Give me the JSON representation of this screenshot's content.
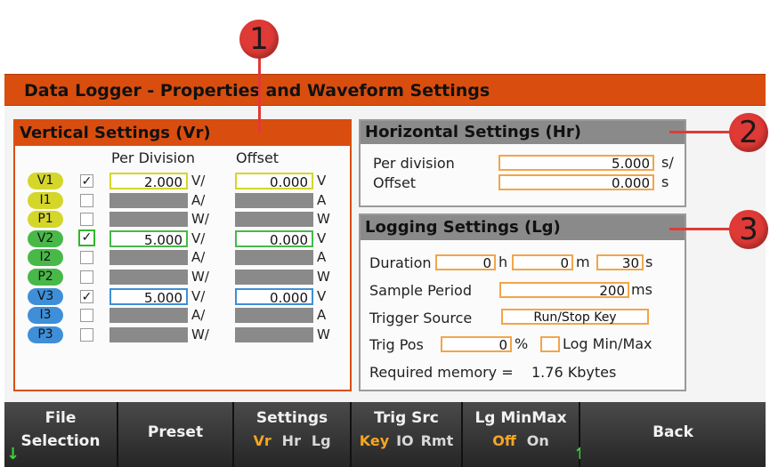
{
  "title": "Data Logger - Properties and Waveform Settings",
  "callouts": [
    "1",
    "2",
    "3"
  ],
  "vertical": {
    "heading": "Vertical Settings (Vr)",
    "col_per_div": "Per Division",
    "col_offset": "Offset",
    "rows": [
      {
        "label": "V1",
        "checked": "✓",
        "per_div": "2.000",
        "per_unit": "V/",
        "offset": "0.000",
        "off_unit": "V",
        "color": "#d4d62a"
      },
      {
        "label": "I1",
        "checked": "",
        "per_div": "",
        "per_unit": "A/",
        "offset": "",
        "off_unit": "A",
        "color": "#d4d62a"
      },
      {
        "label": "P1",
        "checked": "",
        "per_div": "",
        "per_unit": "W/",
        "offset": "",
        "off_unit": "W",
        "color": "#d4d62a"
      },
      {
        "label": "V2",
        "checked": "✓",
        "per_div": "5.000",
        "per_unit": "V/",
        "offset": "0.000",
        "off_unit": "V",
        "color": "#48b848"
      },
      {
        "label": "I2",
        "checked": "",
        "per_div": "",
        "per_unit": "A/",
        "offset": "",
        "off_unit": "A",
        "color": "#48b848"
      },
      {
        "label": "P2",
        "checked": "",
        "per_div": "",
        "per_unit": "W/",
        "offset": "",
        "off_unit": "W",
        "color": "#48b848"
      },
      {
        "label": "V3",
        "checked": "✓",
        "per_div": "5.000",
        "per_unit": "V/",
        "offset": "0.000",
        "off_unit": "V",
        "color": "#3e8fd8"
      },
      {
        "label": "I3",
        "checked": "",
        "per_div": "",
        "per_unit": "A/",
        "offset": "",
        "off_unit": "A",
        "color": "#3e8fd8"
      },
      {
        "label": "P3",
        "checked": "",
        "per_div": "",
        "per_unit": "W/",
        "offset": "",
        "off_unit": "W",
        "color": "#3e8fd8"
      }
    ]
  },
  "horizontal": {
    "heading": "Horizontal Settings (Hr)",
    "per_division_label": "Per division",
    "per_division_value": "5.000",
    "per_division_unit": "s/",
    "offset_label": "Offset",
    "offset_value": "0.000",
    "offset_unit": "s"
  },
  "logging": {
    "heading": "Logging Settings (Lg)",
    "duration_label": "Duration",
    "duration_h": "0",
    "h_unit": "h",
    "duration_m": "0",
    "m_unit": "m",
    "duration_s": "30",
    "s_unit": "s",
    "sample_label": "Sample Period",
    "sample_value": "200",
    "sample_unit": "ms",
    "trigger_label": "Trigger Source",
    "trigger_value": "Run/Stop Key",
    "trigpos_label": "Trig Pos",
    "trigpos_value": "0",
    "trigpos_unit": "%",
    "logminmax_label": "Log Min/Max",
    "memory_label": "Required memory =",
    "memory_value": "1.76 Kbytes"
  },
  "softkeys": {
    "file_line1": "File",
    "file_line2": "Selection",
    "preset": "Preset",
    "settings": "Settings",
    "settings_opts": [
      "Vr",
      "Hr",
      "Lg"
    ],
    "trig": "Trig Src",
    "trig_opts": [
      "Key",
      "IO",
      "Rmt"
    ],
    "lgminmax": "Lg MinMax",
    "lg_opts": [
      "Off",
      "On"
    ],
    "back": "Back"
  },
  "colors": {
    "accent_orange": "#d94e0e",
    "active_option": "#f5a623",
    "callout_red": "#e03a36"
  }
}
